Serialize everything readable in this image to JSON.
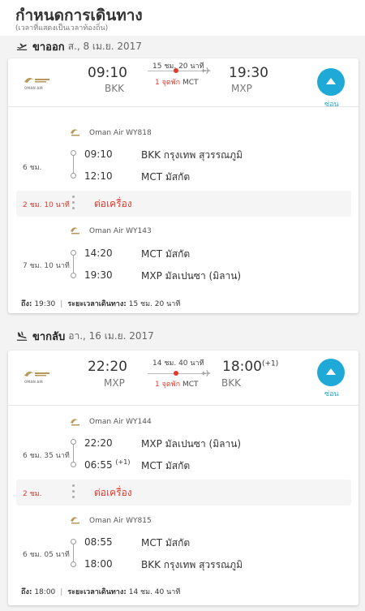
{
  "header": {
    "title": "กำหนดการเดินทาง",
    "subtitle": "(เวลาที่แสดงเป็นเวลาท้องถิ่น)"
  },
  "outbound": {
    "label": "ขาออก",
    "date": "ส., 8 เม.ย. 2017",
    "airline_logo_text": "OMAN AIR",
    "dep_time": "09:10",
    "dep_code": "BKK",
    "arr_time": "19:30",
    "arr_code": "MXP",
    "arr_day_offset": "",
    "total_duration": "15 ชม. 20 นาที",
    "stops_label": "1 จุดพัก",
    "stop_airport": "MCT",
    "toggle_label": "ซ่อน",
    "legs": [
      {
        "carrier": "Oman Air WY818",
        "duration": "6 ชม.",
        "dep_time": "09:10",
        "dep_offset": "",
        "dep_place": "BKK กรุงเทพ สุวรรณภูมิ",
        "arr_time": "12:10",
        "arr_offset": "",
        "arr_place": "MCT มัสกัต"
      },
      {
        "carrier": "Oman Air WY143",
        "duration": "7 ชม. 10 นาที",
        "dep_time": "14:20",
        "dep_offset": "",
        "dep_place": "MCT มัสกัต",
        "arr_time": "19:30",
        "arr_offset": "",
        "arr_place": "MXP มัลเปนซา (มิลาน)"
      }
    ],
    "layover": {
      "duration": "2 ชม. 10 นาที",
      "label": "ต่อเครื่อง"
    },
    "footer": {
      "arrive_label": "ถึง:",
      "arrive_time": "19:30",
      "duration_label": "ระยะเวลาเดินทาง:",
      "duration_value": "15 ชม. 20 นาที"
    }
  },
  "inbound": {
    "label": "ขากลับ",
    "date": "อา., 16 เม.ย. 2017",
    "airline_logo_text": "OMAN AIR",
    "dep_time": "22:20",
    "dep_code": "MXP",
    "arr_time": "18:00",
    "arr_code": "BKK",
    "arr_day_offset": "(+1)",
    "total_duration": "14 ชม. 40 นาที",
    "stops_label": "1 จุดพัก",
    "stop_airport": "MCT",
    "toggle_label": "ซ่อน",
    "legs": [
      {
        "carrier": "Oman Air WY144",
        "duration": "6 ชม. 35 นาที",
        "dep_time": "22:20",
        "dep_offset": "",
        "dep_place": "MXP มัลเปนซา (มิลาน)",
        "arr_time": "06:55",
        "arr_offset": "(+1)",
        "arr_place": "MCT มัสกัต"
      },
      {
        "carrier": "Oman Air WY815",
        "duration": "6 ชม. 05 นาที",
        "dep_time": "08:55",
        "dep_offset": "",
        "dep_place": "MCT มัสกัต",
        "arr_time": "18:00",
        "arr_offset": "",
        "arr_place": "BKK กรุงเทพ สุวรรณภูมิ"
      }
    ],
    "layover": {
      "duration": "2 ชม.",
      "label": "ต่อเครื่อง"
    },
    "footer": {
      "arrive_label": "ถึง:",
      "arrive_time": "18:00",
      "duration_label": "ระยะเวลาเดินทาง:",
      "duration_value": "14 ชม. 40 นาที"
    }
  },
  "colors": {
    "accent": "#1fa9d6",
    "alert": "#e0392b",
    "logo_gold": "#b8985a"
  },
  "icons": {
    "departure": "plane-takeoff-icon",
    "return": "plane-landing-icon",
    "airline": "oman-air-logo",
    "route": "plane-icon",
    "toggle": "caret-up-icon"
  }
}
